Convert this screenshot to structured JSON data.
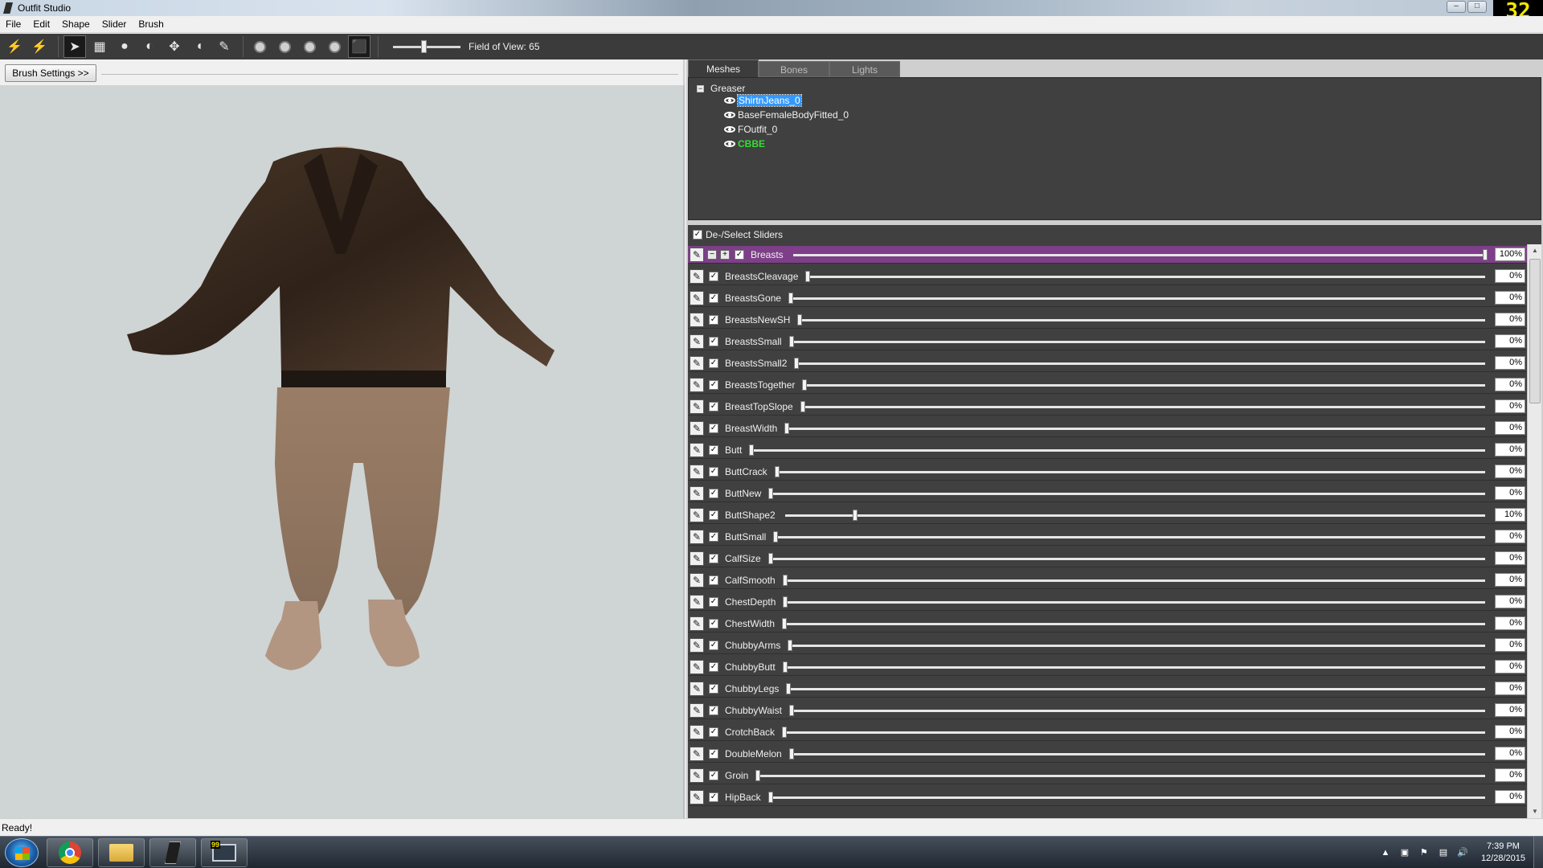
{
  "window": {
    "title": "Outfit Studio",
    "fps": "32"
  },
  "menu": [
    "File",
    "Edit",
    "Shape",
    "Slider",
    "Brush"
  ],
  "toolbar": {
    "fov_label": "Field of View: 65",
    "fov_level": 0.45
  },
  "brush_settings_label": "Brush Settings >>",
  "tabs": [
    "Meshes",
    "Bones",
    "Lights"
  ],
  "tree": {
    "root": "Greaser",
    "items": [
      {
        "label": "ShirtnJeans_0",
        "selected": true,
        "reference": false
      },
      {
        "label": "BaseFemaleBodyFitted_0",
        "selected": false,
        "reference": false
      },
      {
        "label": "FOutfit_0",
        "selected": false,
        "reference": false
      },
      {
        "label": "CBBE",
        "selected": false,
        "reference": true
      }
    ]
  },
  "sliders_header": "De-/Select Sliders",
  "sliders": [
    {
      "name": "Breasts",
      "percent": "100%",
      "value": 100,
      "active": true
    },
    {
      "name": "BreastsCleavage",
      "percent": "0%",
      "value": 0
    },
    {
      "name": "BreastsGone",
      "percent": "0%",
      "value": 0
    },
    {
      "name": "BreastsNewSH",
      "percent": "0%",
      "value": 0
    },
    {
      "name": "BreastsSmall",
      "percent": "0%",
      "value": 0
    },
    {
      "name": "BreastsSmall2",
      "percent": "0%",
      "value": 0
    },
    {
      "name": "BreastsTogether",
      "percent": "0%",
      "value": 0
    },
    {
      "name": "BreastTopSlope",
      "percent": "0%",
      "value": 0
    },
    {
      "name": "BreastWidth",
      "percent": "0%",
      "value": 0
    },
    {
      "name": "Butt",
      "percent": "0%",
      "value": 0
    },
    {
      "name": "ButtCrack",
      "percent": "0%",
      "value": 0
    },
    {
      "name": "ButtNew",
      "percent": "0%",
      "value": 0
    },
    {
      "name": "ButtShape2",
      "percent": "10%",
      "value": 10
    },
    {
      "name": "ButtSmall",
      "percent": "0%",
      "value": 0
    },
    {
      "name": "CalfSize",
      "percent": "0%",
      "value": 0
    },
    {
      "name": "CalfSmooth",
      "percent": "0%",
      "value": 0
    },
    {
      "name": "ChestDepth",
      "percent": "0%",
      "value": 0
    },
    {
      "name": "ChestWidth",
      "percent": "0%",
      "value": 0
    },
    {
      "name": "ChubbyArms",
      "percent": "0%",
      "value": 0
    },
    {
      "name": "ChubbyButt",
      "percent": "0%",
      "value": 0
    },
    {
      "name": "ChubbyLegs",
      "percent": "0%",
      "value": 0
    },
    {
      "name": "ChubbyWaist",
      "percent": "0%",
      "value": 0
    },
    {
      "name": "CrotchBack",
      "percent": "0%",
      "value": 0
    },
    {
      "name": "DoubleMelon",
      "percent": "0%",
      "value": 0
    },
    {
      "name": "Groin",
      "percent": "0%",
      "value": 0
    },
    {
      "name": "HipBack",
      "percent": "0%",
      "value": 0
    }
  ],
  "status": "Ready!",
  "taskbar": {
    "apps": [
      "chrome-icon",
      "folder-icon",
      "outfit-studio-icon",
      "monitor-icon"
    ],
    "monitor_badge": "99",
    "time": "7:39 PM",
    "date": "12/28/2015"
  },
  "colors": {
    "active_slider": "#7d3f87",
    "viewport_bg": "#cfd4d4",
    "panel_bg": "#404040",
    "reference_mesh": "#33dd33",
    "selection": "#3399ff"
  }
}
